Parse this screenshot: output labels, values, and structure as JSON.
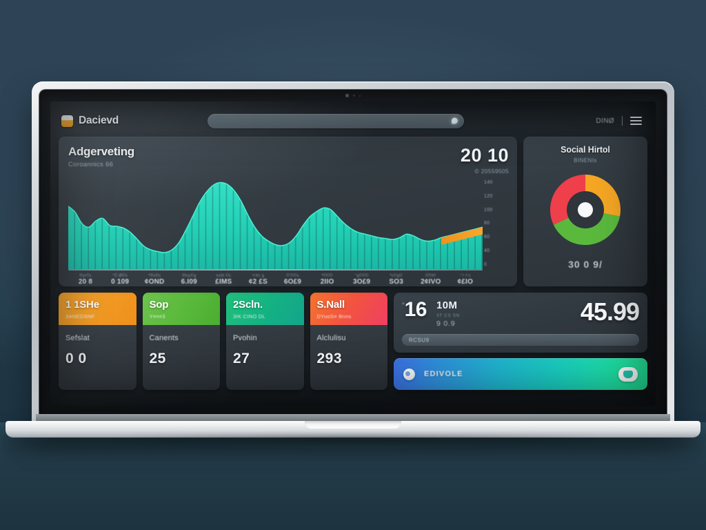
{
  "backdrop": {
    "wall_color": "#2e4456",
    "desk_color": "#23404f"
  },
  "device": {
    "type": "laptop",
    "lid_color": "#d8dcdf",
    "bezel_color": "#13161a",
    "camera_label": "webcam"
  },
  "appbar": {
    "brand_name": "Dacievd",
    "brand_mark_icon": "app-logo-icon",
    "search_placeholder": "",
    "search_icon": "search-icon",
    "link_label": "DINØ",
    "menu_icon": "hamburger-menu-icon"
  },
  "chart_card": {
    "title": "Adgerveting",
    "subtitle": "Coroannics 66",
    "kpi_value": "20 10",
    "kpi_sub": "©  20559505"
  },
  "chart_data": {
    "type": "area",
    "title": "Adgerveting",
    "subtitle": "Coroannics 66",
    "xlabel": "",
    "ylabel": "",
    "grid": false,
    "legend": "none",
    "ylim": [
      0,
      100
    ],
    "accent_color": "#21d0b5",
    "highlight_color": "#f0921e",
    "bar_texture": true,
    "x": [
      "20 8",
      "0 109",
      "¢OND",
      "6.I09",
      "£IMS",
      "¢2 £S",
      "6O£9",
      "2IIO",
      "3O£9",
      "SO3",
      "2¢IVO",
      "¢£IO"
    ],
    "xtick_top": [
      "®yr©c",
      "°© Ø©s",
      "ª®c®s",
      "®trµ©g",
      "¤cth ©c",
      "¹t'¢c g",
      "©'©©s",
      "ª©©©",
      "°g©©©",
      "ªc©g©",
      "©©t©",
      "°? t°c"
    ],
    "ytick_labels": [
      "140",
      "120",
      "100",
      "80",
      "60",
      "40",
      "0"
    ],
    "series": [
      {
        "name": "traffic",
        "values": [
          72,
          65,
          52,
          48,
          55,
          58,
          50,
          49,
          47,
          42,
          34,
          26,
          22,
          20,
          19,
          22,
          30,
          44,
          60,
          76,
          88,
          96,
          99,
          97,
          90,
          78,
          62,
          48,
          38,
          32,
          28,
          27,
          30,
          38,
          50,
          60,
          66,
          70,
          68,
          60,
          52,
          46,
          42,
          40,
          38,
          36,
          35,
          34,
          36,
          40,
          38,
          34,
          32,
          33,
          36,
          38,
          40,
          42,
          44,
          46,
          48
        ]
      },
      {
        "name": "forecast-highlight",
        "values": [
          40,
          42,
          44,
          46,
          48
        ],
        "color": "#f0921e"
      }
    ]
  },
  "donut_card": {
    "title": "Social Hirtol",
    "subtitle": "BINENIs",
    "value_label": "30 0 9/",
    "chart": {
      "type": "pie",
      "segments": [
        {
          "label": "segment-orange",
          "value": 28,
          "color": "#f5a623"
        },
        {
          "label": "segment-green",
          "value": 40,
          "color": "#5ab93d"
        },
        {
          "label": "segment-red",
          "value": 32,
          "color": "#ef3f4a"
        }
      ],
      "hub_color": "#2b3238",
      "center_dot_color": "#ffffff"
    }
  },
  "kpi_cards": [
    {
      "head": "1 1SHe",
      "head_sub": "3ANEDSNF",
      "label": "Sefslat",
      "value": "0 0",
      "accent": "#f2981f"
    },
    {
      "head": "Sop",
      "head_sub": "Y¤¤¤3",
      "label": "Canents",
      "value": "25",
      "accent": "#57b839"
    },
    {
      "head": "2Scln.",
      "head_sub": "3IK CINO DL",
      "label": "Pvohin",
      "value": "27",
      "accent": "#14b183"
    },
    {
      "head": "S.Nall",
      "head_sub": "DYuoS¤ Bnns",
      "label": "Alclulisu",
      "value": "293",
      "accent": "#f2543f"
    }
  ],
  "stats_panel": {
    "prefix": "°",
    "big_number": "16",
    "mid_title": "10M",
    "mid_meta": "3T CS SN",
    "mid_number": "9 0.9",
    "big_right": "45.99",
    "progress_label": "RCSU9",
    "progress_percent": 0
  },
  "cta": {
    "label": "EDIVOLE",
    "left_icon": "user-avatar-icon",
    "right_icon": "badge-icon",
    "gradient_from": "#3b6fe0",
    "gradient_to": "#25e89a"
  }
}
